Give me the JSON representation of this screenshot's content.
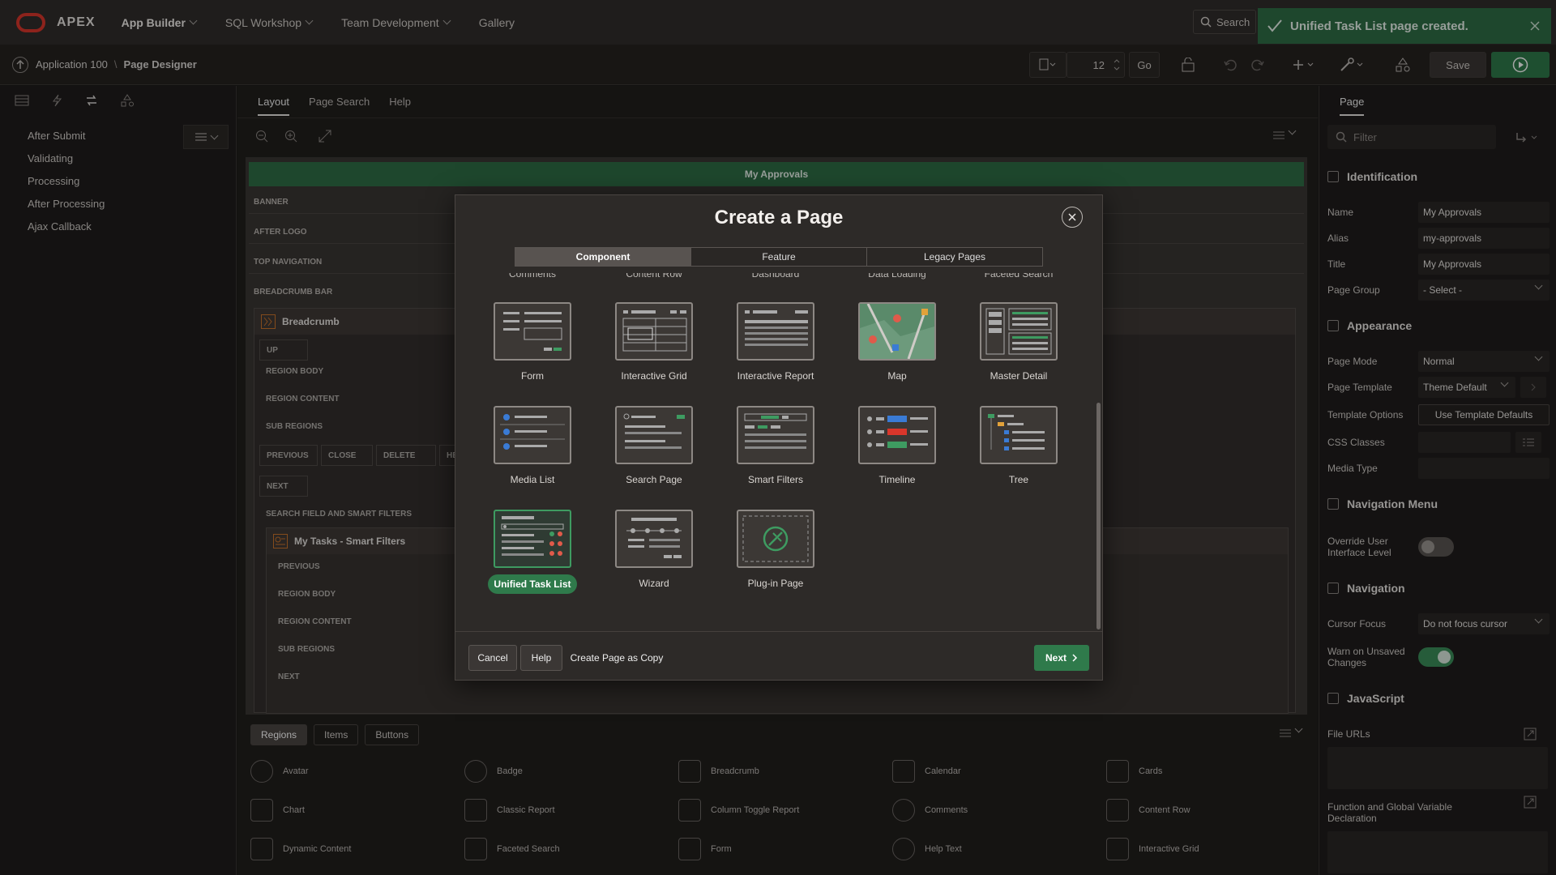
{
  "topbar": {
    "logo_text": "APEX",
    "nav": [
      "App Builder",
      "SQL Workshop",
      "Team Development",
      "Gallery"
    ],
    "search_label": "Search",
    "toast_message": "Unified Task List page created."
  },
  "subbar": {
    "app_crumb": "Application 100",
    "page_crumb": "Page Designer",
    "page_number": "12",
    "go_label": "Go",
    "save_label": "Save"
  },
  "left_tree": [
    "After Submit",
    "Validating",
    "Processing",
    "After Processing",
    "Ajax Callback"
  ],
  "center": {
    "tabs": [
      "Layout",
      "Page Search",
      "Help"
    ],
    "page_title": "My Approvals",
    "slots": [
      "BANNER",
      "AFTER LOGO",
      "TOP NAVIGATION",
      "BREADCRUMB BAR"
    ],
    "breadcrumb_region": "Breadcrumb",
    "region_slots": [
      "UP",
      "REGION BODY",
      "REGION CONTENT",
      "SUB REGIONS"
    ],
    "button_slots": [
      "PREVIOUS",
      "CLOSE",
      "DELETE",
      "HEL"
    ],
    "next_slot": "NEXT",
    "search_slot": "SEARCH FIELD AND SMART FILTERS",
    "smart_region": "My Tasks - Smart Filters",
    "inner_slots": [
      "PREVIOUS",
      "REGION BODY",
      "REGION CONTENT",
      "SUB REGIONS",
      "NEXT"
    ]
  },
  "modal": {
    "title": "Create a Page",
    "segments": [
      "Component",
      "Feature",
      "Legacy Pages"
    ],
    "cut_labels": [
      "Comments",
      "Content Row",
      "Dashboard",
      "Data Loading",
      "Faceted Search"
    ],
    "tiles": [
      "Form",
      "Interactive Grid",
      "Interactive Report",
      "Map",
      "Master Detail",
      "Media List",
      "Search Page",
      "Smart Filters",
      "Timeline",
      "Tree",
      "Unified Task List",
      "Wizard",
      "Plug-in Page"
    ],
    "selected_tile": "Unified Task List",
    "cancel": "Cancel",
    "help": "Help",
    "copy": "Create Page as Copy",
    "next": "Next"
  },
  "gallery": {
    "tabs": [
      "Regions",
      "Items",
      "Buttons"
    ],
    "items": [
      "Avatar",
      "Badge",
      "Breadcrumb",
      "Calendar",
      "Cards",
      "Chart",
      "Classic Report",
      "Column Toggle Report",
      "Comments",
      "Content Row",
      "Dynamic Content",
      "Faceted Search",
      "Form",
      "Help Text",
      "Interactive Grid"
    ]
  },
  "properties": {
    "tab": "Page",
    "filter_placeholder": "Filter",
    "identification": {
      "header": "Identification",
      "name_label": "Name",
      "name": "My Approvals",
      "alias_label": "Alias",
      "alias": "my-approvals",
      "title_label": "Title",
      "title": "My Approvals",
      "group_label": "Page Group",
      "group": "- Select -"
    },
    "appearance": {
      "header": "Appearance",
      "mode_label": "Page Mode",
      "mode": "Normal",
      "template_label": "Page Template",
      "template": "Theme Default",
      "options_label": "Template Options",
      "options_button": "Use Template Defaults",
      "css_label": "CSS Classes",
      "media_label": "Media Type"
    },
    "navigation_menu": {
      "header": "Navigation Menu",
      "override_label": "Override User Interface Level"
    },
    "navigation": {
      "header": "Navigation",
      "cursor_label": "Cursor Focus",
      "cursor": "Do not focus cursor",
      "warn_label": "Warn on Unsaved Changes"
    },
    "javascript": {
      "header": "JavaScript",
      "file_urls_label": "File URLs",
      "func_label": "Function and Global Variable Declaration"
    }
  }
}
